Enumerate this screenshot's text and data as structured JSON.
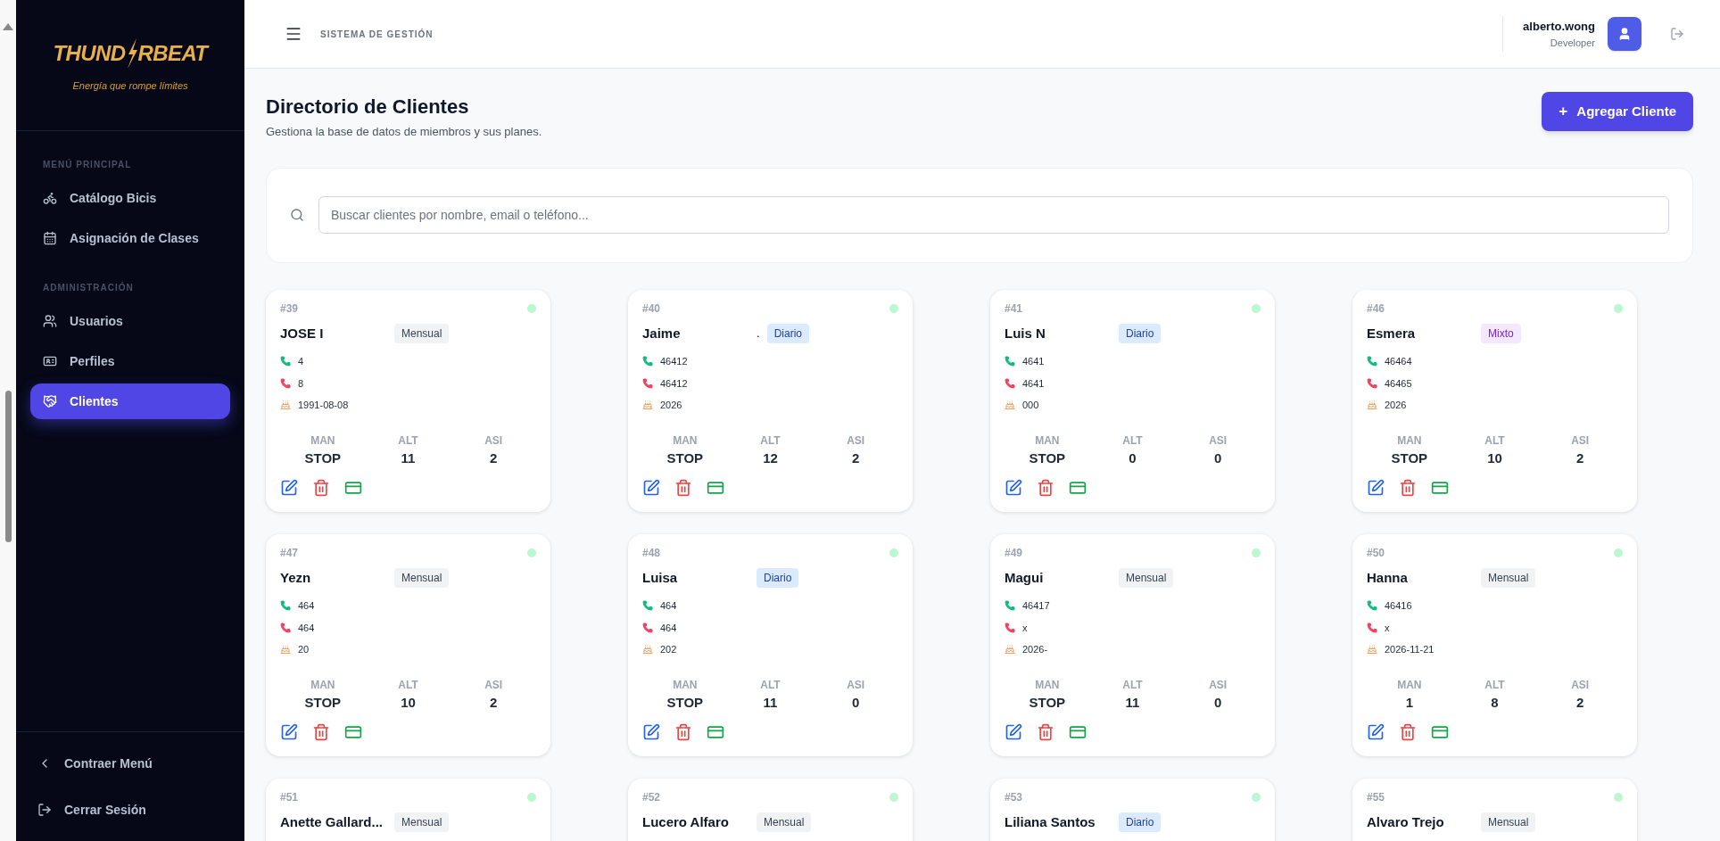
{
  "sidebar": {
    "logo": {
      "left": "THUND",
      "right": "RBEAT",
      "tagline": "Energía que rompe límites"
    },
    "sections": [
      {
        "label": "MENÚ PRINCIPAL",
        "items": [
          {
            "label": "Catálogo Bicis",
            "selected": false
          },
          {
            "label": "Asignación de Clases",
            "selected": false
          }
        ]
      },
      {
        "label": "ADMINISTRACIÓN",
        "items": [
          {
            "label": "Usuarios",
            "selected": false
          },
          {
            "label": "Perfiles",
            "selected": false
          },
          {
            "label": "Clientes",
            "selected": true
          }
        ]
      }
    ],
    "footer": [
      "Contraer Menú",
      "Cerrar Sesión"
    ]
  },
  "header": {
    "title": "SISTEMA DE GESTIÓN",
    "user": {
      "name": "alberto.wong",
      "role": "Developer"
    }
  },
  "page": {
    "title": "Directorio de Clientes",
    "subtitle": "Gestiona la base de datos de miembros y sus planes.",
    "add_button": "Agregar Cliente",
    "add_icon": "+",
    "search": {
      "placeholder": "Buscar clientes por nombre, email o teléfono..."
    }
  },
  "clients": [
    {
      "id": "#39",
      "name": "JOSE I",
      "plan": "Mensual",
      "kind": "mensual",
      "active": true,
      "phone": "4",
      "phone2": "8",
      "date": "1991-08-08",
      "stats": [
        {
          "label": "MAN",
          "value": "STOP"
        },
        {
          "label": "ALT",
          "value": "11"
        },
        {
          "label": "ASI",
          "value": "2"
        }
      ]
    },
    {
      "id": "#40",
      "name": "Jaime",
      "name_tail": ".",
      "plan": "Diario",
      "kind": "diario",
      "active": true,
      "phone": "46412",
      "phone2": "46412",
      "date": "2026",
      "stats": [
        {
          "label": "MAN",
          "value": "STOP"
        },
        {
          "label": "ALT",
          "value": "12"
        },
        {
          "label": "ASI",
          "value": "2"
        }
      ]
    },
    {
      "id": "#41",
      "name": "Luis N",
      "plan": "Diario",
      "kind": "diario",
      "active": true,
      "phone": "4641",
      "phone2": "4641",
      "date": "000",
      "stats": [
        {
          "label": "MAN",
          "value": "STOP"
        },
        {
          "label": "ALT",
          "value": "0"
        },
        {
          "label": "ASI",
          "value": "0"
        }
      ]
    },
    {
      "id": "#46",
      "name": "Esmera",
      "plan": "Mixto",
      "kind": "mixto",
      "active": true,
      "phone": "46464",
      "phone2": "46465",
      "date": "2026",
      "stats": [
        {
          "label": "MAN",
          "value": "STOP"
        },
        {
          "label": "ALT",
          "value": "10"
        },
        {
          "label": "ASI",
          "value": "2"
        }
      ]
    },
    {
      "id": "#47",
      "name": "Yezn",
      "plan": "Mensual",
      "kind": "mensual",
      "active": true,
      "phone": "464",
      "phone2": "464",
      "date": "20",
      "stats": [
        {
          "label": "MAN",
          "value": "STOP"
        },
        {
          "label": "ALT",
          "value": "10"
        },
        {
          "label": "ASI",
          "value": "2"
        }
      ]
    },
    {
      "id": "#48",
      "name": "Luisa",
      "plan": "Diario",
      "kind": "diario",
      "active": true,
      "phone": "464",
      "phone2": "464",
      "date": "202",
      "stats": [
        {
          "label": "MAN",
          "value": "STOP"
        },
        {
          "label": "ALT",
          "value": "11"
        },
        {
          "label": "ASI",
          "value": "0"
        }
      ]
    },
    {
      "id": "#49",
      "name": "Magui",
      "plan": "Mensual",
      "kind": "mensual",
      "active": true,
      "phone": "46417",
      "phone2": "x",
      "date": "2026-",
      "stats": [
        {
          "label": "MAN",
          "value": "STOP"
        },
        {
          "label": "ALT",
          "value": "11"
        },
        {
          "label": "ASI",
          "value": "0"
        }
      ]
    },
    {
      "id": "#50",
      "name": "Hanna",
      "plan": "Mensual",
      "kind": "mensual",
      "active": true,
      "phone": "46416",
      "phone2": "x",
      "date": "2026-11-21",
      "stats": [
        {
          "label": "MAN",
          "value": "1"
        },
        {
          "label": "ALT",
          "value": "8"
        },
        {
          "label": "ASI",
          "value": "2"
        }
      ]
    },
    {
      "id": "#51",
      "name": "Anette Gallard...",
      "plan": "Mensual",
      "kind": "mensual",
      "active": true
    },
    {
      "id": "#52",
      "name": "Lucero Alfaro",
      "plan": "Mensual",
      "kind": "mensual",
      "active": true
    },
    {
      "id": "#53",
      "name": "Liliana Santos",
      "plan": "Diario",
      "kind": "diario",
      "active": true
    },
    {
      "id": "#55",
      "name": "Alvaro Trejo",
      "plan": "Mensual",
      "kind": "mensual",
      "active": true
    }
  ]
}
